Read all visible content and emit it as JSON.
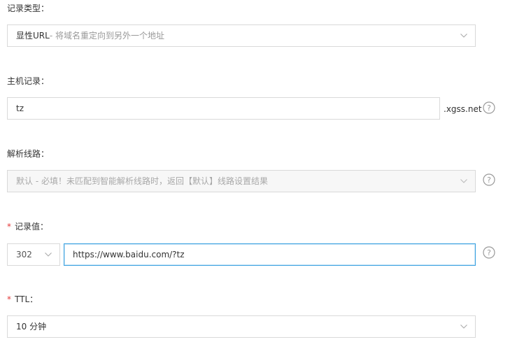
{
  "record_type": {
    "label": "记录类型：",
    "selected_main": "显性URL",
    "selected_hint": "- 将域名重定向到另外一个地址"
  },
  "host_record": {
    "label": "主机记录：",
    "value": "tz",
    "suffix": ".xgss.net"
  },
  "resolve_line": {
    "label": "解析线路：",
    "value": "默认 - 必填！未匹配到智能解析线路时，返回【默认】线路设置结果"
  },
  "record_value": {
    "required_mark": "*",
    "label": "记录值：",
    "redirect_code": "302",
    "url": "https://www.baidu.com/?tz"
  },
  "ttl": {
    "required_mark": "*",
    "label": "TTL：",
    "value": "10 分钟"
  },
  "colors": {
    "border": "#d9d9d9",
    "focus_border": "#3aa1e0",
    "required": "#e33a3a",
    "disabled_bg": "#f7f7f7"
  }
}
